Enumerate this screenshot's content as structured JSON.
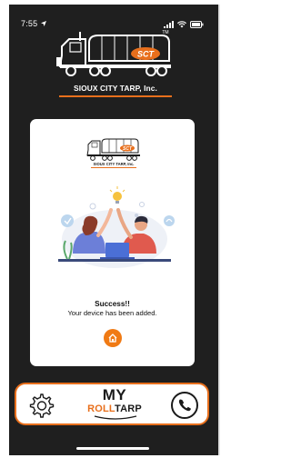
{
  "status_bar": {
    "time": "7:55",
    "location_icon": "location-arrow-icon",
    "signal_icon": "cellular-signal-icon",
    "wifi_icon": "wifi-icon",
    "battery_icon": "battery-icon"
  },
  "header": {
    "logo_icon": "truck-logo-icon",
    "logo_initials": "SCT",
    "trademark": "TM",
    "company_name": "SIOUX CITY TARP, Inc."
  },
  "card": {
    "mini_logo_initials": "SCT",
    "mini_logo_name": "SIOUX CITY TARP, Inc.",
    "illustration": "high-five-illustration",
    "success_title": "Success!!",
    "success_message": "Your device has been added.",
    "home_icon": "home-icon"
  },
  "bottom_bar": {
    "settings_icon": "gear-icon",
    "brand_top": "MY",
    "brand_roll": "ROLL",
    "brand_tarp": "TARP",
    "phone_icon": "phone-icon"
  },
  "colors": {
    "accent": "#e86f1c",
    "background": "#1f1f1f",
    "card": "#ffffff"
  }
}
